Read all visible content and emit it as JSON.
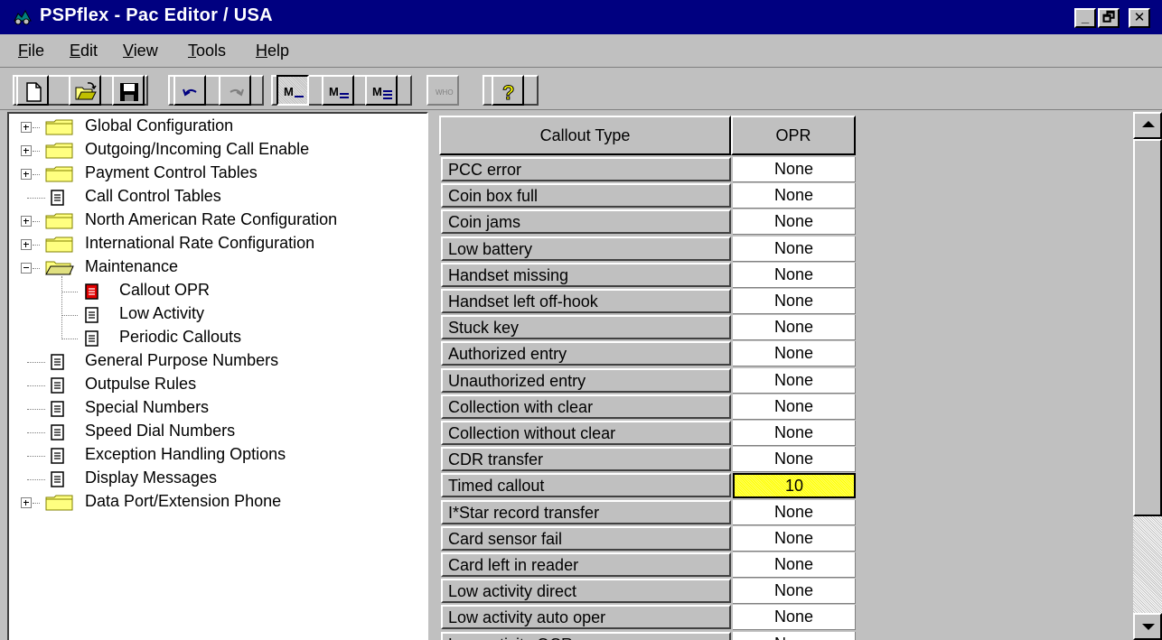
{
  "window": {
    "title": "PSPflex - Pac Editor / USA",
    "controls": [
      "_",
      "🗗",
      "✕"
    ]
  },
  "menu": [
    {
      "label": "File",
      "accel": "F",
      "rest": "ile"
    },
    {
      "label": "Edit",
      "accel": "E",
      "rest": "dit"
    },
    {
      "label": "View",
      "accel": "V",
      "rest": "iew"
    },
    {
      "label": "Tools",
      "accel": "T",
      "rest": "ools"
    },
    {
      "label": "Help",
      "accel": "H",
      "rest": "elp"
    }
  ],
  "toolbar": {
    "buttons": [
      "new-icon",
      "open-folder-icon",
      "save-icon",
      "undo-icon",
      "redo-icon",
      "view-mode-1-icon",
      "view-mode-2-icon",
      "view-mode-3-icon",
      "who-icon",
      "help-icon"
    ],
    "who_label": "WHO"
  },
  "tree": [
    {
      "label": "Global Configuration",
      "type": "folder",
      "expander": "plus",
      "level": 0
    },
    {
      "label": "Outgoing/Incoming Call Enable",
      "type": "folder",
      "expander": "plus",
      "level": 0
    },
    {
      "label": "Payment Control Tables",
      "type": "folder",
      "expander": "plus",
      "level": 0
    },
    {
      "label": "Call Control Tables",
      "type": "doc",
      "expander": "none",
      "level": 0
    },
    {
      "label": "North American Rate Configuration",
      "type": "folder",
      "expander": "plus",
      "level": 0
    },
    {
      "label": "International Rate Configuration",
      "type": "folder",
      "expander": "plus",
      "level": 0
    },
    {
      "label": "Maintenance",
      "type": "folder-open",
      "expander": "minus",
      "level": 0
    },
    {
      "label": "Callout OPR",
      "type": "doc-red",
      "expander": "none",
      "level": 1
    },
    {
      "label": "Low Activity",
      "type": "doc",
      "expander": "none",
      "level": 1
    },
    {
      "label": "Periodic Callouts",
      "type": "doc",
      "expander": "none",
      "level": 1
    },
    {
      "label": "General Purpose Numbers",
      "type": "doc",
      "expander": "none",
      "level": 0
    },
    {
      "label": "Outpulse Rules",
      "type": "doc",
      "expander": "none",
      "level": 0
    },
    {
      "label": "Special Numbers",
      "type": "doc",
      "expander": "none",
      "level": 0
    },
    {
      "label": "Speed Dial Numbers",
      "type": "doc",
      "expander": "none",
      "level": 0
    },
    {
      "label": "Exception Handling Options",
      "type": "doc",
      "expander": "none",
      "level": 0
    },
    {
      "label": "Display Messages",
      "type": "doc",
      "expander": "none",
      "level": 0
    },
    {
      "label": "Data Port/Extension Phone",
      "type": "folder",
      "expander": "plus",
      "level": 0
    }
  ],
  "grid": {
    "headers": [
      "Callout Type",
      "OPR"
    ],
    "rows": [
      {
        "type": "PCC error",
        "opr": "None"
      },
      {
        "type": "Coin box full",
        "opr": "None"
      },
      {
        "type": "Coin jams",
        "opr": "None"
      },
      {
        "type": "Low battery",
        "opr": "None"
      },
      {
        "type": "Handset missing",
        "opr": "None"
      },
      {
        "type": "Handset left off-hook",
        "opr": "None"
      },
      {
        "type": "Stuck key",
        "opr": "None"
      },
      {
        "type": "Authorized entry",
        "opr": "None"
      },
      {
        "type": "Unauthorized entry",
        "opr": "None"
      },
      {
        "type": "Collection with clear",
        "opr": "None"
      },
      {
        "type": "Collection without clear",
        "opr": "None"
      },
      {
        "type": "CDR transfer",
        "opr": "None"
      },
      {
        "type": "Timed callout",
        "opr": "10",
        "selected": true
      },
      {
        "type": "I*Star record transfer",
        "opr": "None"
      },
      {
        "type": "Card sensor fail",
        "opr": "None"
      },
      {
        "type": "Card left in reader",
        "opr": "None"
      },
      {
        "type": "Low activity direct",
        "opr": "None"
      },
      {
        "type": "Low activity auto oper",
        "opr": "None"
      },
      {
        "type": "Low activity OCR",
        "opr": "None"
      }
    ]
  },
  "colors": {
    "title_bar": "#000080",
    "face": "#c0c0c0",
    "selected_cell": "#ffff00",
    "folder": "#ffff80",
    "active_doc": "#e00000"
  }
}
